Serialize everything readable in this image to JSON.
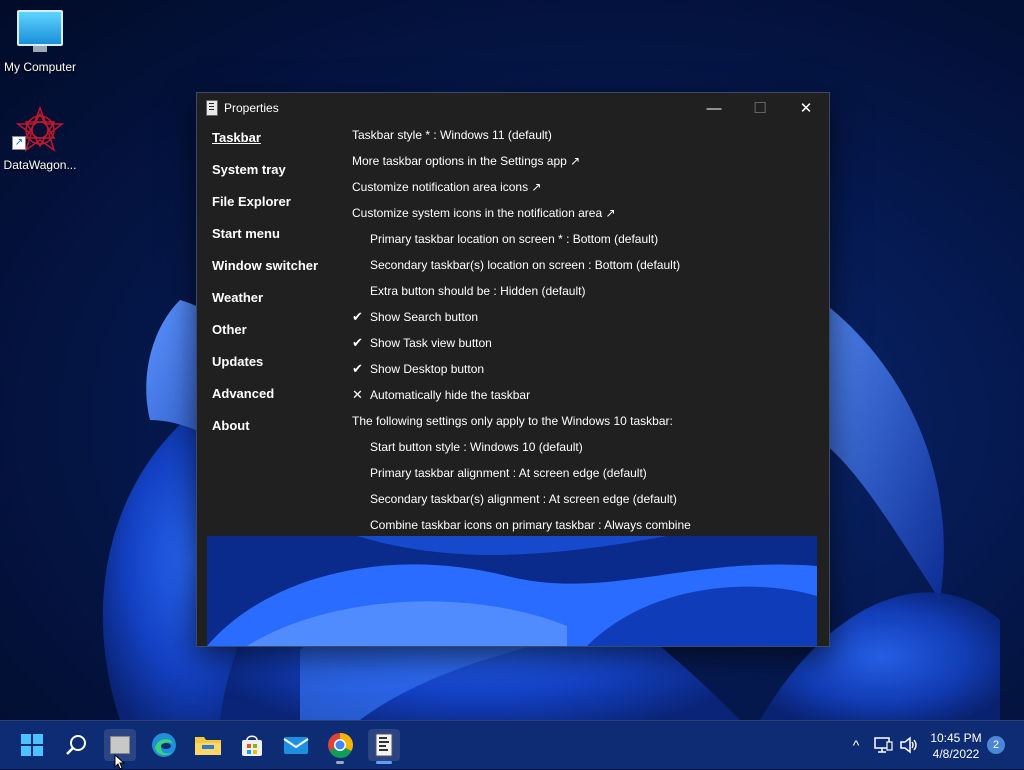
{
  "desktop": {
    "icons": [
      {
        "label": "My Computer"
      },
      {
        "label": "DataWagon..."
      }
    ]
  },
  "window": {
    "title": "Properties",
    "controls": {
      "minimize": "—",
      "maximize": "☐",
      "close": "✕"
    },
    "nav": [
      {
        "label": "Taskbar",
        "active": true
      },
      {
        "label": "System tray"
      },
      {
        "label": "File Explorer"
      },
      {
        "label": "Start menu"
      },
      {
        "label": "Window switcher"
      },
      {
        "label": "Weather"
      },
      {
        "label": "Other"
      },
      {
        "label": "Updates"
      },
      {
        "label": "Advanced"
      },
      {
        "label": "About"
      }
    ],
    "options": [
      {
        "text": "Taskbar style * : Windows 11 (default)"
      },
      {
        "text": "More taskbar options in the Settings app ↗"
      },
      {
        "text": "Customize notification area icons ↗"
      },
      {
        "text": "Customize system icons in the notification area ↗"
      },
      {
        "text": "Primary taskbar location on screen * : Bottom (default)",
        "indent": true
      },
      {
        "text": "Secondary taskbar(s) location on screen : Bottom (default)",
        "indent": true
      },
      {
        "text": "Extra button should be : Hidden (default)",
        "indent": true
      },
      {
        "text": "Show Search button",
        "mark": "✔"
      },
      {
        "text": "Show Task view button",
        "mark": "✔"
      },
      {
        "text": "Show Desktop button",
        "mark": "✔"
      },
      {
        "text": "Automatically hide the taskbar",
        "mark": "✕"
      },
      {
        "text": "The following settings only apply to the Windows 10 taskbar:"
      },
      {
        "text": "Start button style : Windows 10 (default)",
        "indent": true
      },
      {
        "text": "Primary taskbar alignment : At screen edge (default)",
        "indent": true
      },
      {
        "text": "Secondary taskbar(s) alignment : At screen edge (default)",
        "indent": true
      },
      {
        "text": "Combine taskbar icons on primary taskbar : Always combine",
        "indent": true
      }
    ]
  },
  "taskbar": {
    "apps": [
      "start-icon",
      "search-icon",
      "explorer-window-icon",
      "edge-icon",
      "file-explorer-icon",
      "store-icon",
      "mail-icon",
      "chrome-icon",
      "properties-app-icon"
    ],
    "tray": {
      "chevron": "^",
      "time": "10:45 PM",
      "date": "4/8/2022",
      "notifications": "2"
    }
  },
  "colors": {
    "accent": "#0e2c74",
    "window_bg": "#202020"
  }
}
